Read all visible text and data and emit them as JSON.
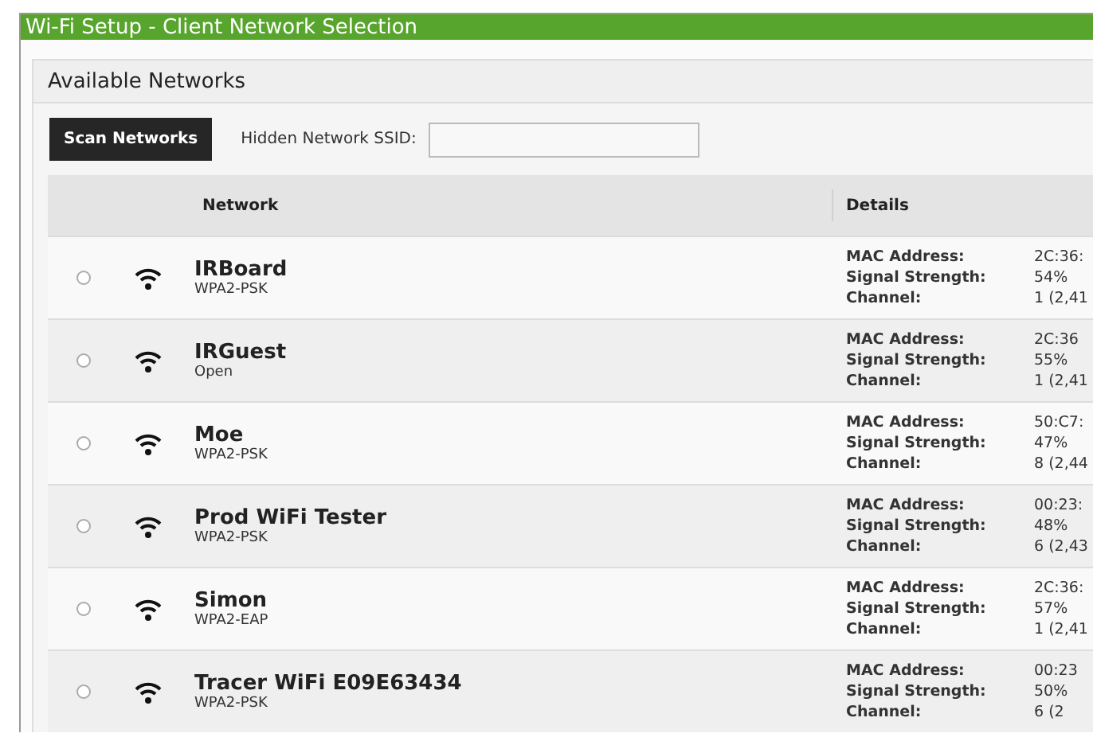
{
  "window": {
    "title": "Wi-Fi Setup - Client Network Selection"
  },
  "panel": {
    "title": "Available Networks"
  },
  "toolbar": {
    "scan_button": "Scan Networks",
    "hidden_ssid": {
      "label": "Hidden Network SSID:"
    }
  },
  "table": {
    "columns": [
      "Network",
      "Details"
    ],
    "rows": [
      {
        "selected": false,
        "name": "IRBoard",
        "security": "WPA2-PSK",
        "details": [
          {
            "label": "MAC Address:",
            "value": "2C:36:"
          },
          {
            "label": "Signal Strength:",
            "value": "54%"
          },
          {
            "label": "Channel:",
            "value": "1 (2,41"
          }
        ]
      },
      {
        "selected": false,
        "name": "IRGuest",
        "security": "Open",
        "details": [
          {
            "label": "MAC Address:",
            "value": "2C:36"
          },
          {
            "label": "Signal Strength:",
            "value": "55%"
          },
          {
            "label": "Channel:",
            "value": "1 (2,41"
          }
        ]
      },
      {
        "selected": false,
        "name": "Moe",
        "security": "WPA2-PSK",
        "details": [
          {
            "label": "MAC Address:",
            "value": "50:C7:"
          },
          {
            "label": "Signal Strength:",
            "value": "47%"
          },
          {
            "label": "Channel:",
            "value": "8 (2,44"
          }
        ]
      },
      {
        "selected": false,
        "name": "Prod WiFi Tester",
        "security": "WPA2-PSK",
        "details": [
          {
            "label": "MAC Address:",
            "value": "00:23:"
          },
          {
            "label": "Signal Strength:",
            "value": "48%"
          },
          {
            "label": "Channel:",
            "value": "6 (2,43"
          }
        ]
      },
      {
        "selected": false,
        "name": "Simon",
        "security": "WPA2-EAP",
        "details": [
          {
            "label": "MAC Address:",
            "value": "2C:36:"
          },
          {
            "label": "Signal Strength:",
            "value": "57%"
          },
          {
            "label": "Channel:",
            "value": "1 (2,41"
          }
        ]
      },
      {
        "selected": false,
        "name": "Tracer WiFi E09E63434",
        "security": "WPA2-PSK",
        "details": [
          {
            "label": "MAC Address:",
            "value": "00:23"
          },
          {
            "label": "Signal Strength:",
            "value": "50%"
          },
          {
            "label": "Channel:",
            "value": "6 (2"
          }
        ]
      }
    ]
  }
}
